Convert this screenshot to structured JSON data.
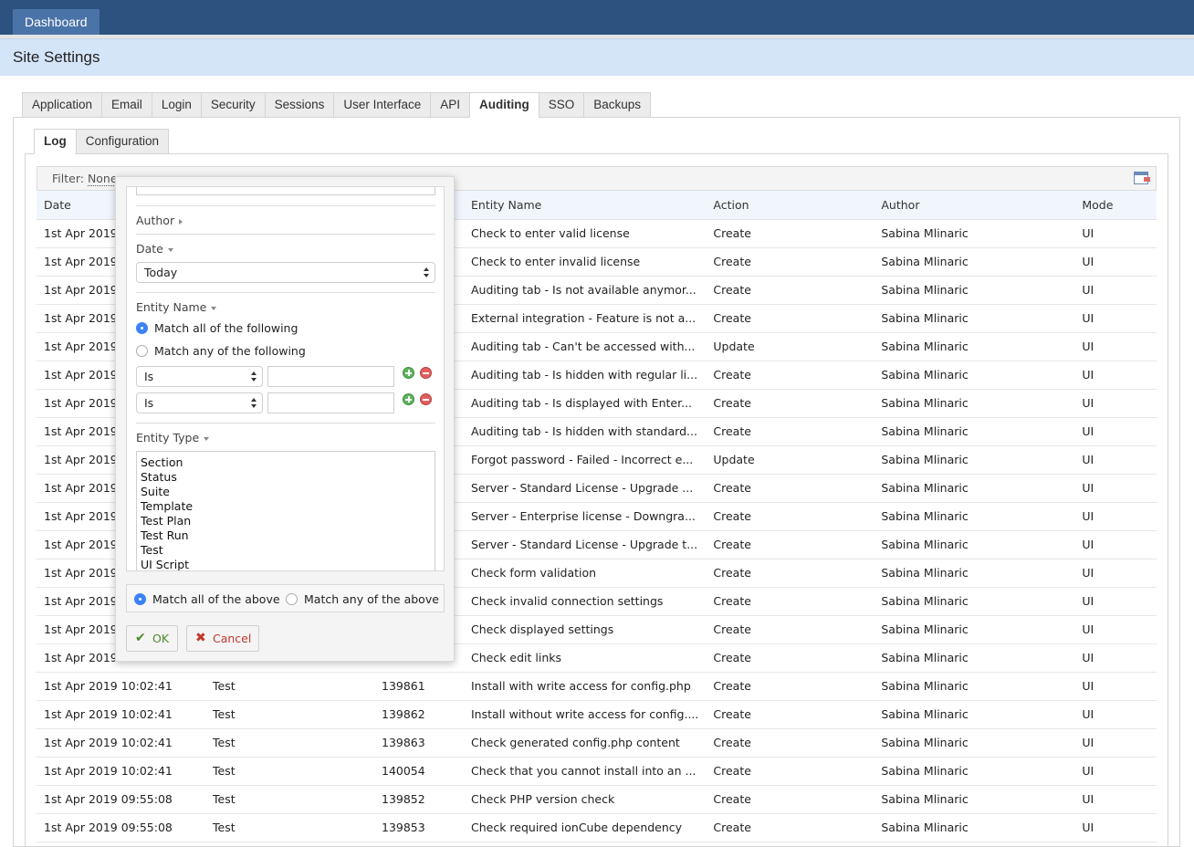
{
  "topbar": {
    "dashboard_label": "Dashboard"
  },
  "page": {
    "title": "Site Settings"
  },
  "main_tabs": [
    {
      "label": "Application",
      "active": false
    },
    {
      "label": "Email",
      "active": false
    },
    {
      "label": "Login",
      "active": false
    },
    {
      "label": "Security",
      "active": false
    },
    {
      "label": "Sessions",
      "active": false
    },
    {
      "label": "User Interface",
      "active": false
    },
    {
      "label": "API",
      "active": false
    },
    {
      "label": "Auditing",
      "active": true
    },
    {
      "label": "SSO",
      "active": false
    },
    {
      "label": "Backups",
      "active": false
    }
  ],
  "sub_tabs": [
    {
      "label": "Log",
      "active": true
    },
    {
      "label": "Configuration",
      "active": false
    }
  ],
  "filter": {
    "label": "Filter:",
    "value": "None"
  },
  "table": {
    "columns": [
      "Date",
      "",
      "",
      "Entity Name",
      "Action",
      "Author",
      "Mode"
    ],
    "rows": [
      {
        "date": "1st Apr 2019",
        "type": "",
        "id": "",
        "entity": "Check to enter valid license",
        "action": "Create",
        "author": "Sabina Mlinaric",
        "mode": "UI"
      },
      {
        "date": "1st Apr 2019",
        "type": "",
        "id": "",
        "entity": "Check to enter invalid license",
        "action": "Create",
        "author": "Sabina Mlinaric",
        "mode": "UI"
      },
      {
        "date": "1st Apr 2019",
        "type": "",
        "id": "",
        "entity": "Auditing tab - Is not available anymor...",
        "action": "Create",
        "author": "Sabina Mlinaric",
        "mode": "UI"
      },
      {
        "date": "1st Apr 2019",
        "type": "",
        "id": "",
        "entity": "External integration - Feature is not a...",
        "action": "Create",
        "author": "Sabina Mlinaric",
        "mode": "UI"
      },
      {
        "date": "1st Apr 2019",
        "type": "",
        "id": "",
        "entity": "Auditing tab - Can't be accessed with...",
        "action": "Update",
        "author": "Sabina Mlinaric",
        "mode": "UI"
      },
      {
        "date": "1st Apr 2019",
        "type": "",
        "id": "",
        "entity": "Auditing tab - Is hidden with regular li...",
        "action": "Create",
        "author": "Sabina Mlinaric",
        "mode": "UI"
      },
      {
        "date": "1st Apr 2019",
        "type": "",
        "id": "",
        "entity": "Auditing tab - Is displayed with Enter...",
        "action": "Create",
        "author": "Sabina Mlinaric",
        "mode": "UI"
      },
      {
        "date": "1st Apr 2019",
        "type": "",
        "id": "",
        "entity": "Auditing tab - Is hidden with standard...",
        "action": "Create",
        "author": "Sabina Mlinaric",
        "mode": "UI"
      },
      {
        "date": "1st Apr 2019",
        "type": "",
        "id": "",
        "entity": "Forgot password - Failed - Incorrect e...",
        "action": "Update",
        "author": "Sabina Mlinaric",
        "mode": "UI"
      },
      {
        "date": "1st Apr 2019",
        "type": "",
        "id": "",
        "entity": "Server - Standard License - Upgrade ...",
        "action": "Create",
        "author": "Sabina Mlinaric",
        "mode": "UI"
      },
      {
        "date": "1st Apr 2019",
        "type": "",
        "id": "",
        "entity": "Server - Enterprise license - Downgra...",
        "action": "Create",
        "author": "Sabina Mlinaric",
        "mode": "UI"
      },
      {
        "date": "1st Apr 2019",
        "type": "",
        "id": "",
        "entity": "Server - Standard License - Upgrade t...",
        "action": "Create",
        "author": "Sabina Mlinaric",
        "mode": "UI"
      },
      {
        "date": "1st Apr 2019",
        "type": "",
        "id": "",
        "entity": "Check form validation",
        "action": "Create",
        "author": "Sabina Mlinaric",
        "mode": "UI"
      },
      {
        "date": "1st Apr 2019",
        "type": "",
        "id": "",
        "entity": "Check invalid connection settings",
        "action": "Create",
        "author": "Sabina Mlinaric",
        "mode": "UI"
      },
      {
        "date": "1st Apr 2019",
        "type": "",
        "id": "",
        "entity": "Check displayed settings",
        "action": "Create",
        "author": "Sabina Mlinaric",
        "mode": "UI"
      },
      {
        "date": "1st Apr 2019",
        "type": "",
        "id": "",
        "entity": "Check edit links",
        "action": "Create",
        "author": "Sabina Mlinaric",
        "mode": "UI"
      },
      {
        "date": "1st Apr 2019 10:02:41",
        "type": "Test",
        "id": "139861",
        "entity": "Install with write access for config.php",
        "action": "Create",
        "author": "Sabina Mlinaric",
        "mode": "UI"
      },
      {
        "date": "1st Apr 2019 10:02:41",
        "type": "Test",
        "id": "139862",
        "entity": "Install without write access for config....",
        "action": "Create",
        "author": "Sabina Mlinaric",
        "mode": "UI"
      },
      {
        "date": "1st Apr 2019 10:02:41",
        "type": "Test",
        "id": "139863",
        "entity": "Check generated config.php content",
        "action": "Create",
        "author": "Sabina Mlinaric",
        "mode": "UI"
      },
      {
        "date": "1st Apr 2019 10:02:41",
        "type": "Test",
        "id": "140054",
        "entity": "Check that you cannot install into an ...",
        "action": "Create",
        "author": "Sabina Mlinaric",
        "mode": "UI"
      },
      {
        "date": "1st Apr 2019 09:55:08",
        "type": "Test",
        "id": "139852",
        "entity": "Check PHP version check",
        "action": "Create",
        "author": "Sabina Mlinaric",
        "mode": "UI"
      },
      {
        "date": "1st Apr 2019 09:55:08",
        "type": "Test",
        "id": "139853",
        "entity": "Check required ionCube dependency",
        "action": "Create",
        "author": "Sabina Mlinaric",
        "mode": "UI"
      }
    ]
  },
  "filter_popup": {
    "author_label": "Author",
    "date_label": "Date",
    "date_value": "Today",
    "entity_name_label": "Entity Name",
    "match_all_following": "Match all of the following",
    "match_any_following": "Match any of the following",
    "conditions": [
      {
        "operator": "Is",
        "value": ""
      },
      {
        "operator": "Is",
        "value": ""
      }
    ],
    "entity_type_label": "Entity Type",
    "entity_types": [
      "Section",
      "Status",
      "Suite",
      "Template",
      "Test Plan",
      "Test Run",
      "Test",
      "UI Script"
    ],
    "match_all_above": "Match all of the above",
    "match_any_above": "Match any of the above",
    "ok_label": "OK",
    "cancel_label": "Cancel"
  }
}
